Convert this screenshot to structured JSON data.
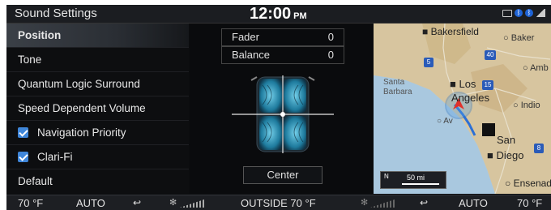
{
  "header": {
    "title": "Sound Settings",
    "time": "12:00",
    "ampm": "PM"
  },
  "menu": {
    "items": [
      {
        "label": "Position",
        "active": true
      },
      {
        "label": "Tone"
      },
      {
        "label": "Quantum Logic Surround"
      },
      {
        "label": "Speed Dependent Volume"
      },
      {
        "label": "Navigation Priority",
        "checked": true
      },
      {
        "label": "Clari-Fi",
        "checked": true
      },
      {
        "label": "Default"
      }
    ]
  },
  "audio": {
    "fader_label": "Fader",
    "fader_value": "0",
    "balance_label": "Balance",
    "balance_value": "0",
    "center_label": "Center"
  },
  "map": {
    "labels": {
      "bakersfield": "Bakersfield",
      "baker": "Baker",
      "amb": "Amb",
      "santa": "Santa",
      "barbara": "Barbara",
      "los": "Los",
      "angeles": "Angeles",
      "indio": "Indio",
      "av": "Av",
      "san": "San",
      "diego": "Diego",
      "ensenad": "Ensenad"
    },
    "highway_shields": [
      "5",
      "40",
      "15",
      "8"
    ],
    "scale_north": "N",
    "scale_distance": "50 mi"
  },
  "climate": {
    "left_temp": "70 °F",
    "left_mode": "AUTO",
    "outside_label": "OUTSIDE",
    "outside_temp": "70 °F",
    "right_mode": "AUTO",
    "right_temp": "70 °F"
  },
  "colors": {
    "accent_blue": "#3f86d9",
    "speaker_cyan": "#3fc1e6",
    "location_red": "#e0322b"
  }
}
